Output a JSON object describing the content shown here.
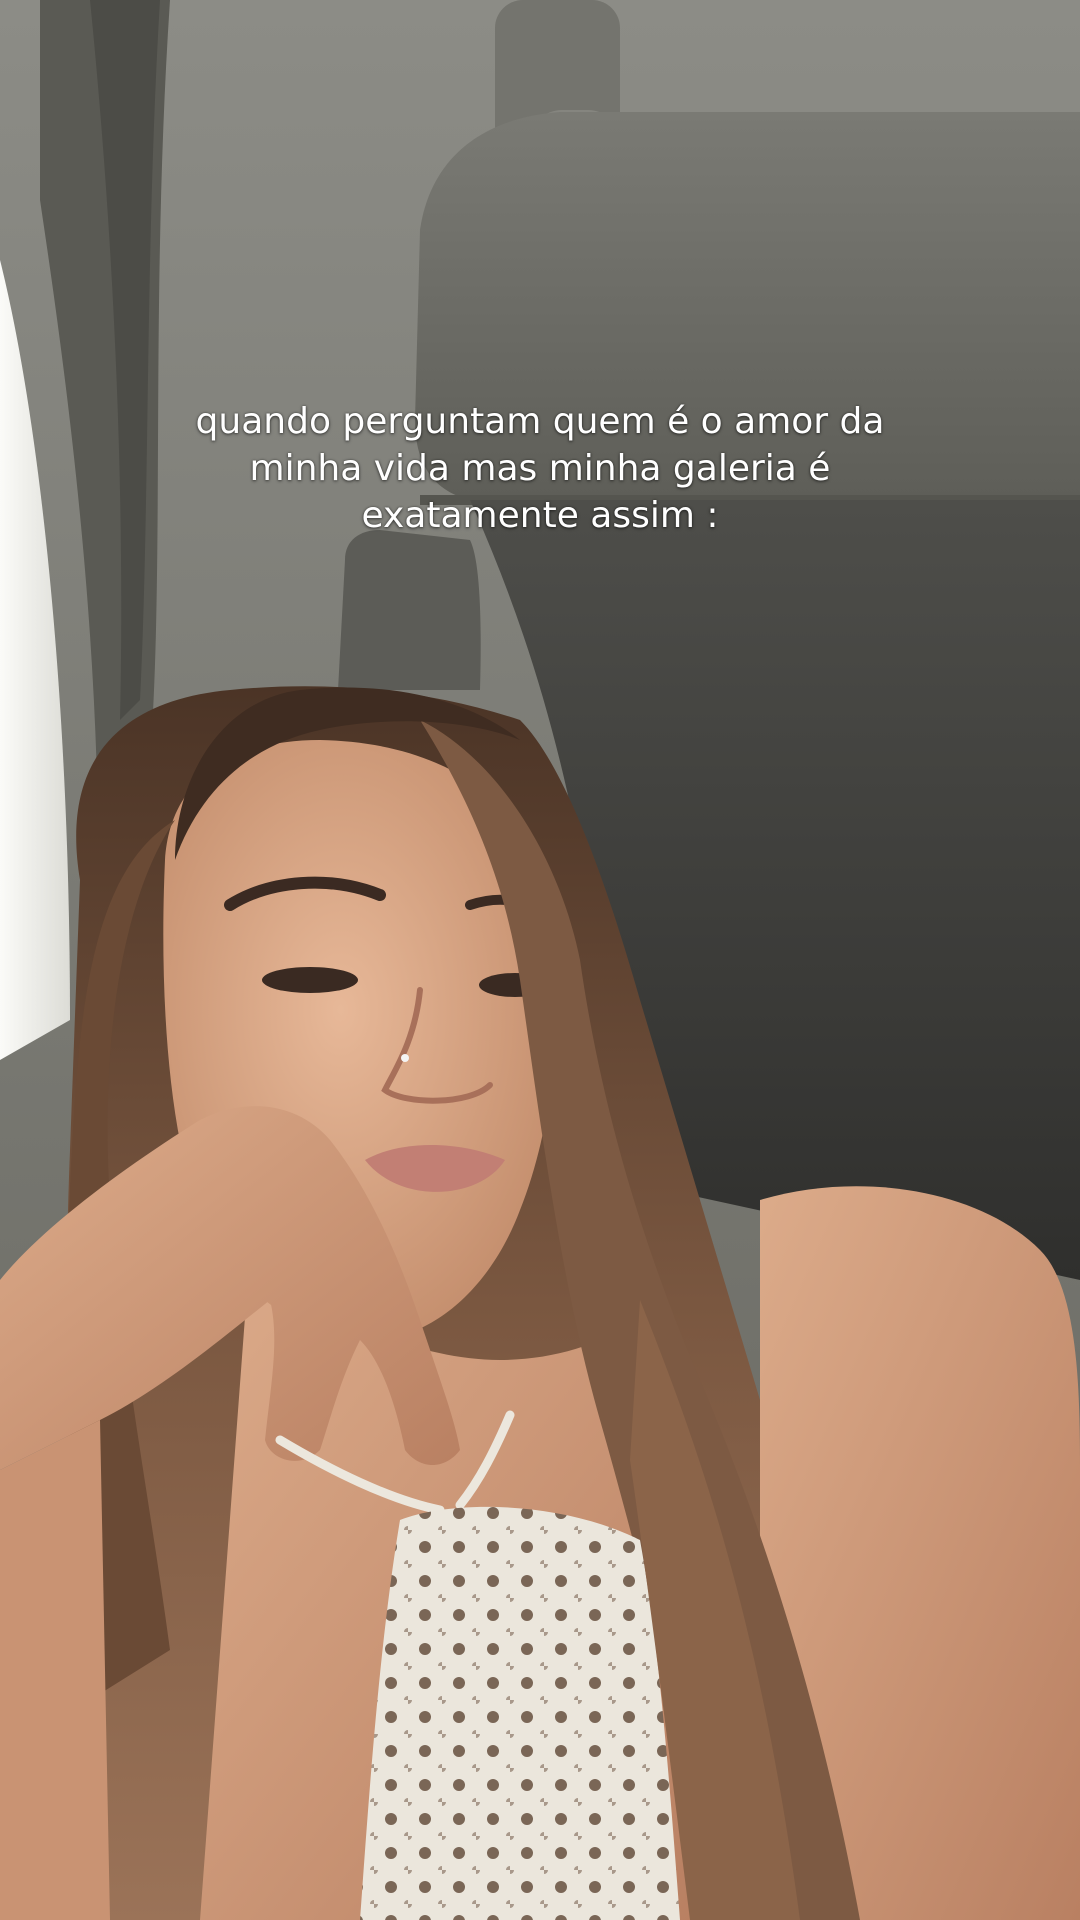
{
  "overlay": {
    "caption": "quando perguntam quem é o amor da minha vida mas minha galeria é exatamente assim :"
  },
  "photo": {
    "scene": "selfie-in-car",
    "colors": {
      "headliner": "#7e7e78",
      "sun_visor": "#6e6e68",
      "window_light": "#f2f2ee",
      "seat_dark": "#3c3c39",
      "skin": "#d9a887",
      "hair": "#6b4a34",
      "crochet_top": "#e9e4da",
      "caption_text": "#ffffff"
    }
  }
}
